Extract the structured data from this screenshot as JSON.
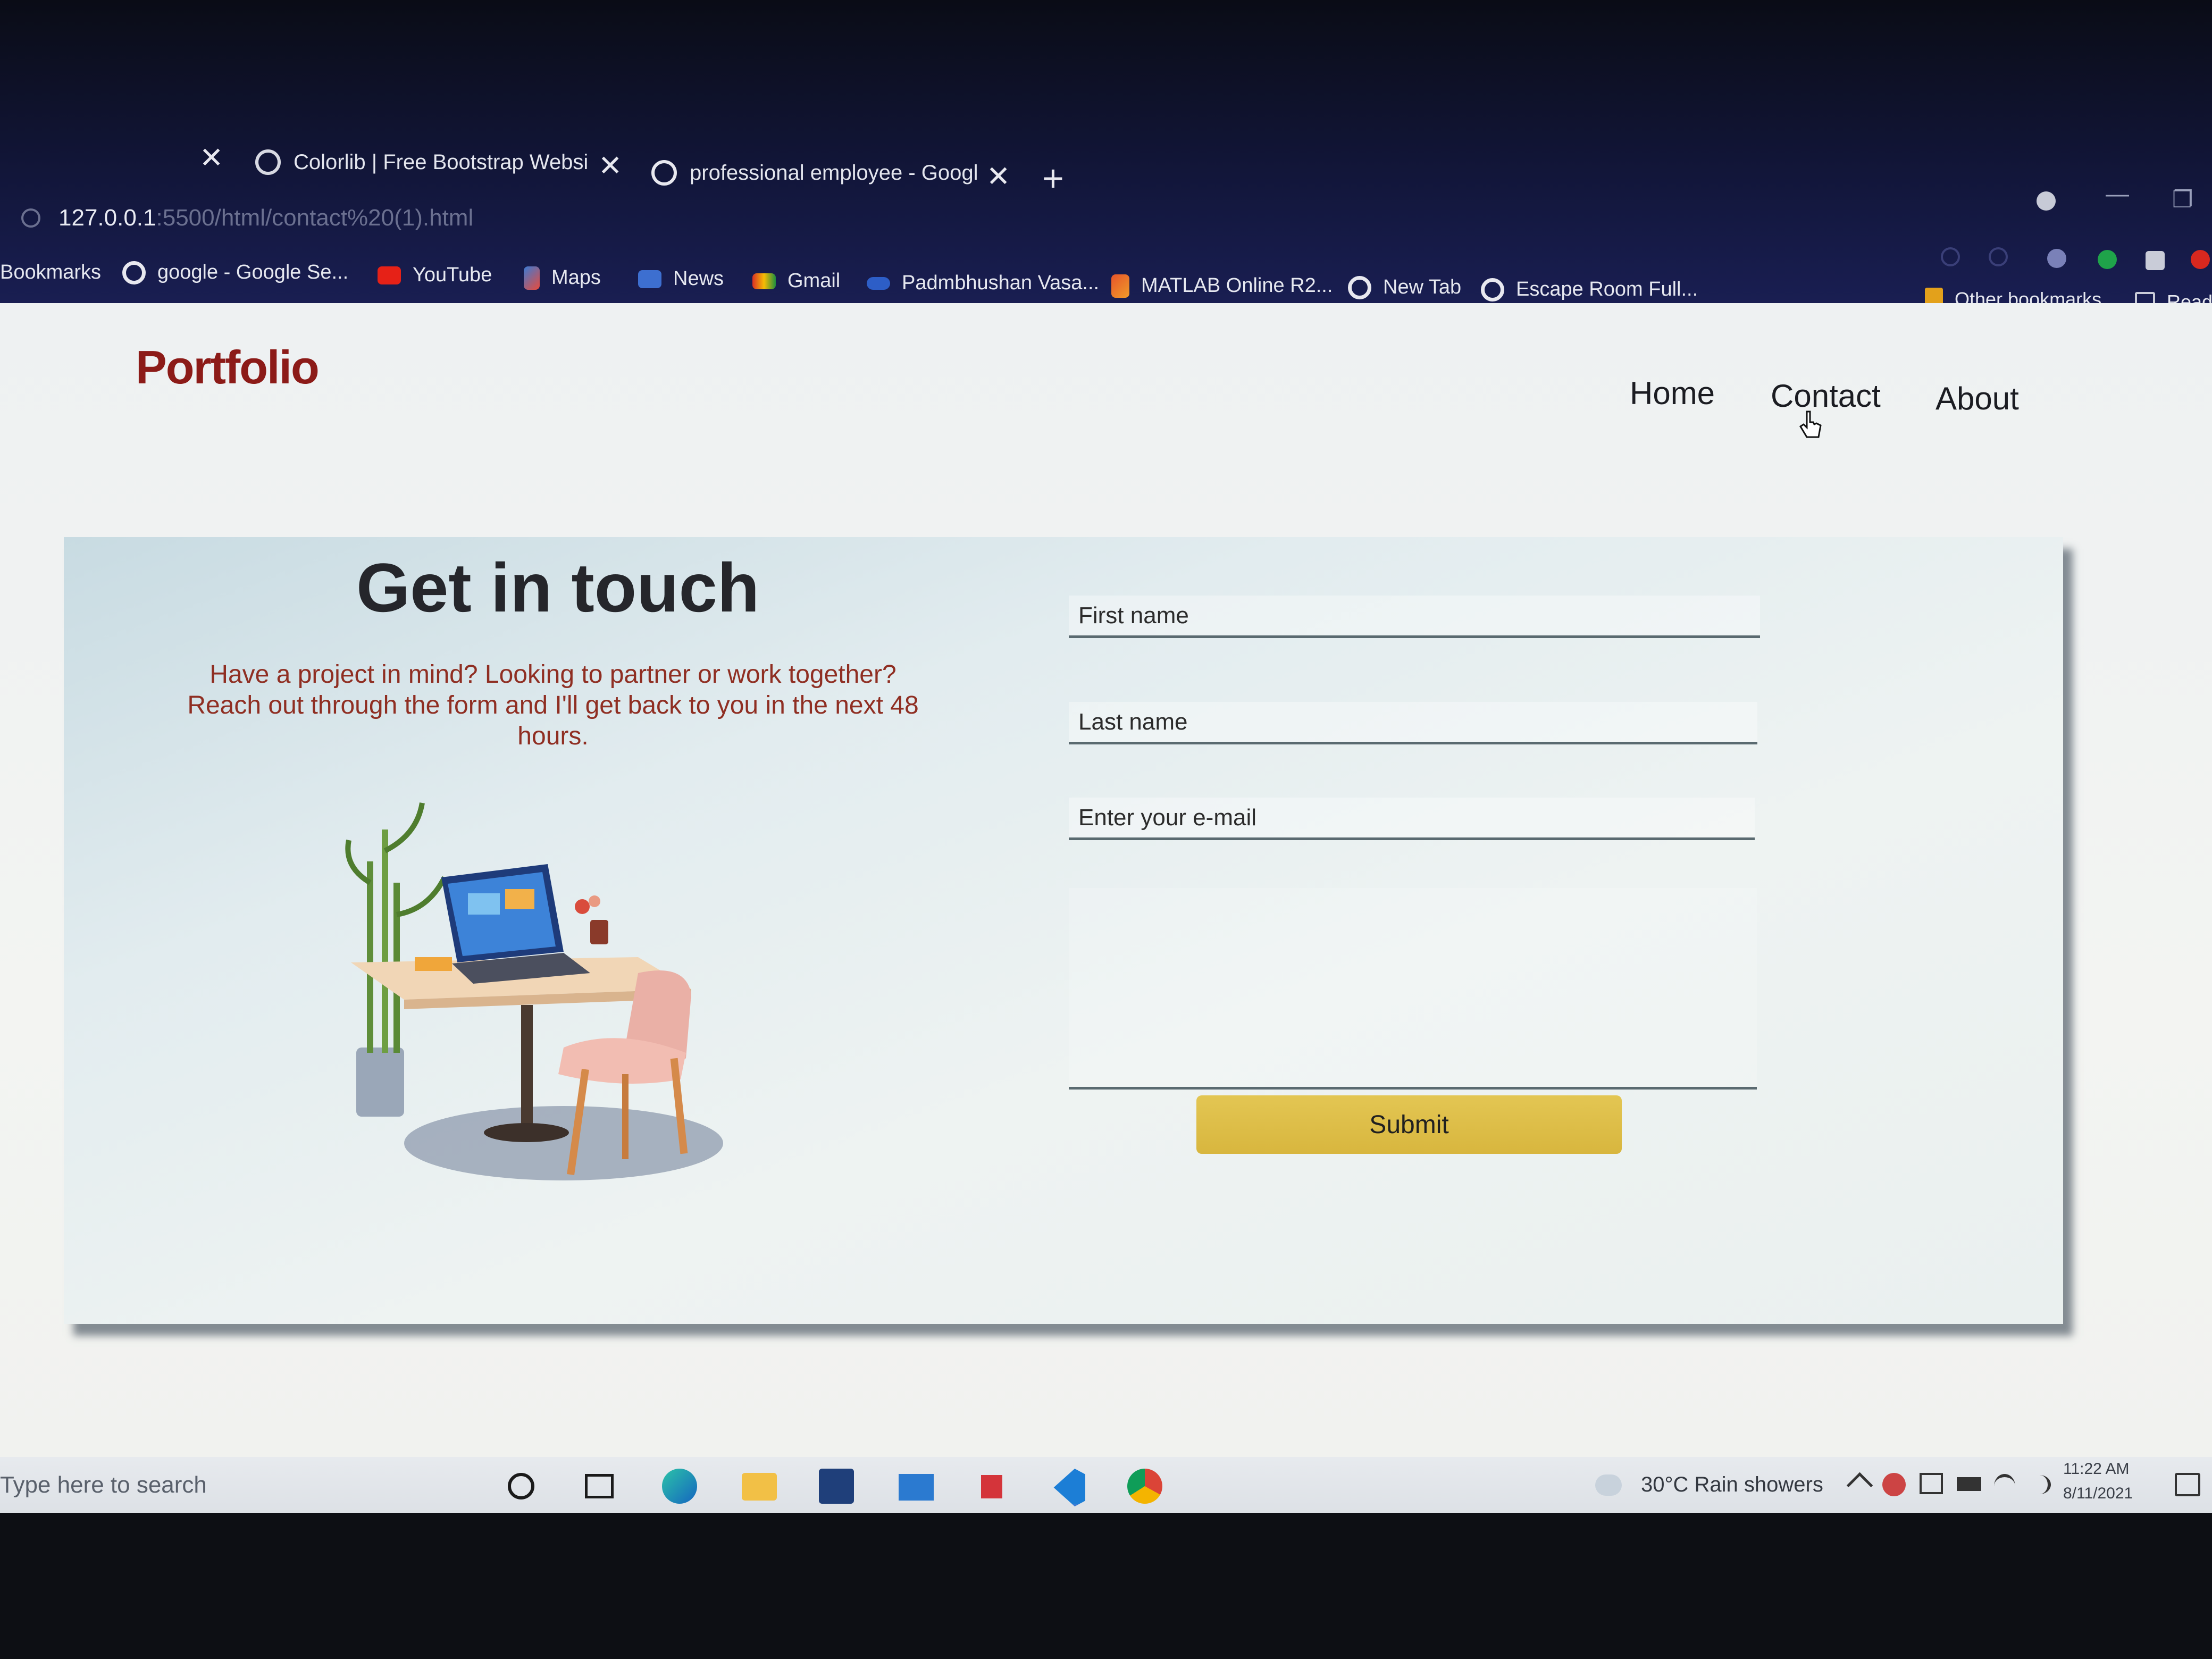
{
  "browser": {
    "tabs": [
      {
        "label": ""
      },
      {
        "label": "Colorlib | Free Bootstrap Websi"
      },
      {
        "label": "professional employee - Googl"
      }
    ],
    "new_tab_symbol": "+",
    "close_symbol": "✕",
    "address": {
      "host": "127.0.0.1",
      "path": ":5500/html/contact%20(1).html"
    },
    "window_controls": {
      "minimize": "—",
      "restore": "❐"
    },
    "bookmarks_label": "Bookmarks",
    "bookmarks": [
      {
        "label": "google - Google Se...",
        "icon": "google-icon"
      },
      {
        "label": "YouTube",
        "icon": "youtube-icon"
      },
      {
        "label": "Maps",
        "icon": "maps-icon"
      },
      {
        "label": "News",
        "icon": "news-icon"
      },
      {
        "label": "Gmail",
        "icon": "gmail-icon"
      },
      {
        "label": "Padmbhushan Vasa...",
        "icon": "link-icon"
      },
      {
        "label": "MATLAB Online R2...",
        "icon": "matlab-icon"
      },
      {
        "label": "New Tab",
        "icon": "globe-icon"
      },
      {
        "label": "Escape Room Full...",
        "icon": "globe-icon"
      }
    ],
    "other_bookmarks": "Other bookmarks",
    "reading_list": "Read"
  },
  "page": {
    "logo": "Portfolio",
    "nav": {
      "home": "Home",
      "contact": "Contact",
      "about": "About"
    },
    "heading": "Get in touch",
    "intro": "Have a project in mind? Looking to partner or work together? Reach out through the form and I'll get back to you in the next 48 hours.",
    "form": {
      "first_name_placeholder": "First name",
      "last_name_placeholder": "Last name",
      "email_placeholder": "Enter your e-mail",
      "message_placeholder": "",
      "submit_label": "Submit"
    }
  },
  "taskbar": {
    "search_placeholder": "Type here to search",
    "weather": "30°C  Rain showers",
    "time": "11:22 AM",
    "date": "8/11/2021",
    "apps": [
      "cortana-icon",
      "task-view-icon",
      "edge-icon",
      "file-explorer-icon",
      "store-icon",
      "mail-icon",
      "gift-icon",
      "vscode-icon",
      "chrome-icon"
    ]
  },
  "colors": {
    "logo": "#8c1b18",
    "intro_text": "#8f2e22",
    "submit": "#dcbc45",
    "chrome_bg": "#1a1f55"
  }
}
